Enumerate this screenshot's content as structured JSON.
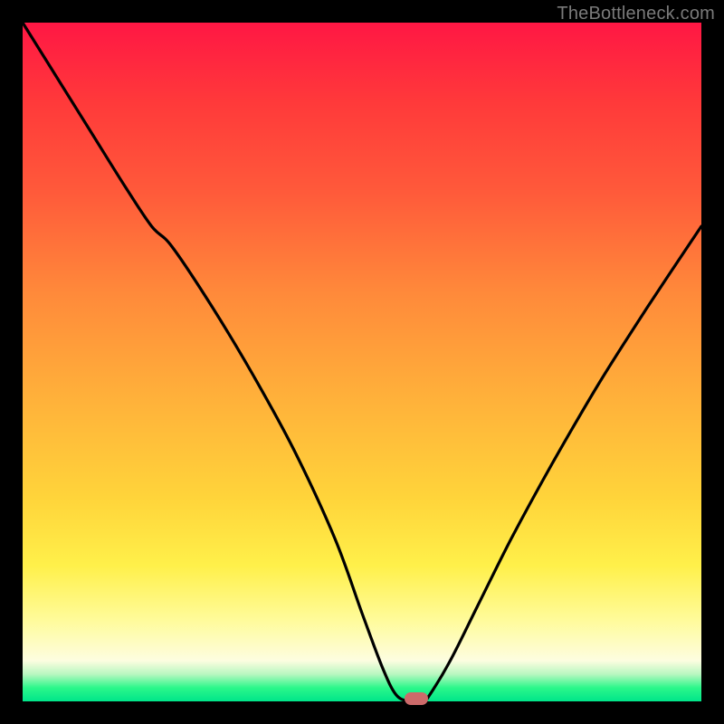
{
  "watermark": "TheBottleneck.com",
  "colors": {
    "frame": "#000000",
    "gradient_top": "#ff1744",
    "gradient_mid": "#ffd43a",
    "gradient_bottom": "#00e58a",
    "curve": "#000000",
    "marker": "#cc6a6a"
  },
  "chart_data": {
    "type": "line",
    "title": "",
    "xlabel": "",
    "ylabel": "",
    "xlim": [
      0,
      100
    ],
    "ylim": [
      0,
      100
    ],
    "series": [
      {
        "name": "bottleneck-curve",
        "x": [
          0,
          5,
          10,
          15,
          19,
          22,
          28,
          34,
          40,
          46,
          50,
          53,
          55,
          57,
          59,
          60,
          63,
          67,
          72,
          78,
          85,
          92,
          100
        ],
        "y": [
          100,
          92,
          84,
          76,
          70,
          67,
          58,
          48,
          37,
          24,
          13,
          5,
          1,
          0,
          0,
          1,
          6,
          14,
          24,
          35,
          47,
          58,
          70
        ]
      }
    ],
    "marker": {
      "x": 58,
      "y": 0,
      "shape": "rounded-rect"
    },
    "annotations": []
  }
}
